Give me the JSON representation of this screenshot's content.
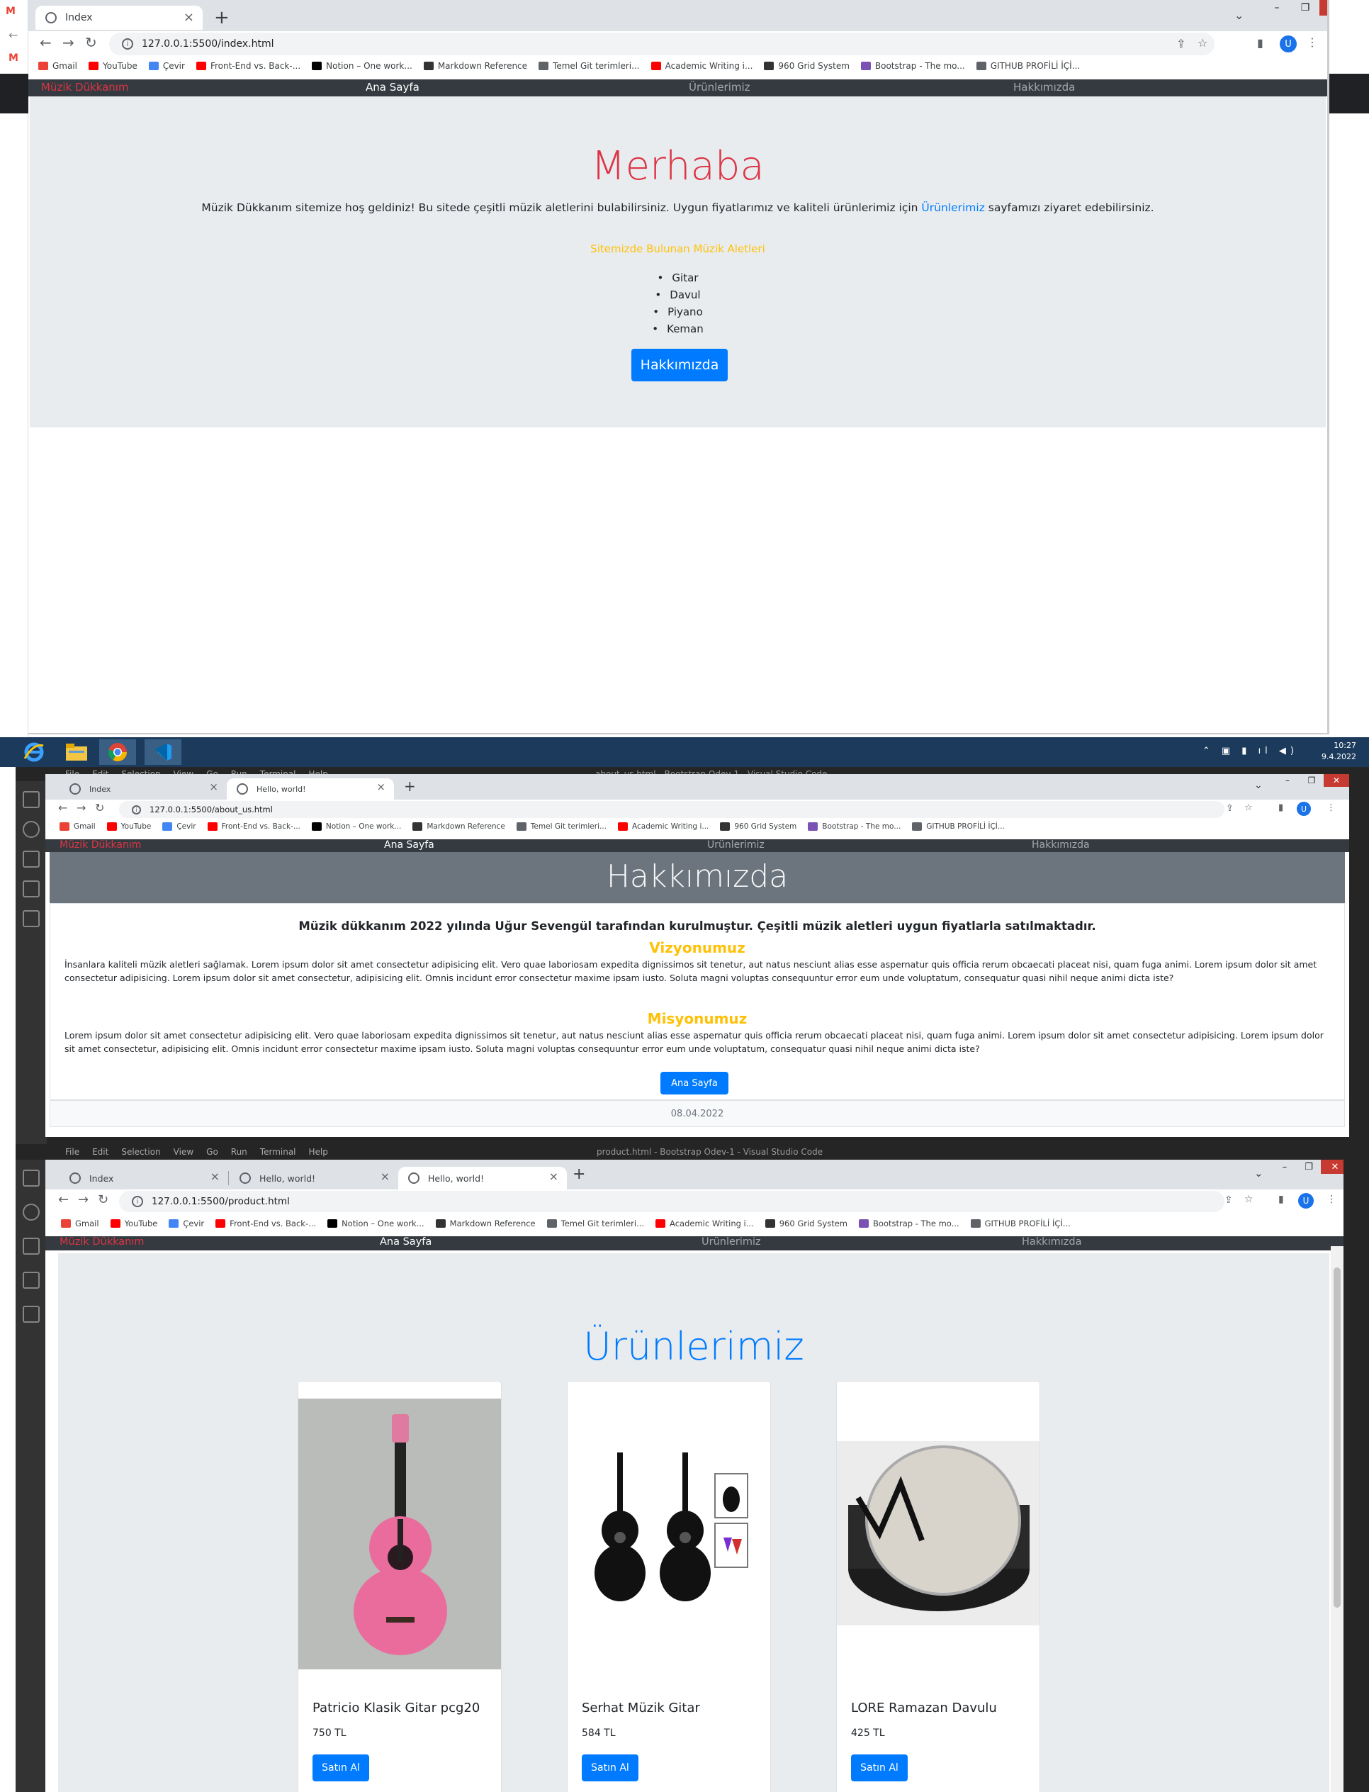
{
  "bookmarks": [
    {
      "label": "Gmail",
      "color": "#ea4335"
    },
    {
      "label": "YouTube",
      "color": "#ff0000"
    },
    {
      "label": "Çevir",
      "color": "#4285f4"
    },
    {
      "label": "Front-End vs. Back-...",
      "color": "#ff0000"
    },
    {
      "label": "Notion – One work...",
      "color": "#000000"
    },
    {
      "label": "Markdown Reference",
      "color": "#333333"
    },
    {
      "label": "Temel Git terimleri...",
      "color": "#5f6368"
    },
    {
      "label": "Academic Writing i...",
      "color": "#ff0000"
    },
    {
      "label": "960 Grid System",
      "color": "#333333"
    },
    {
      "label": "Bootstrap - The mo...",
      "color": "#7952b3"
    },
    {
      "label": "GITHUB PROFİLİ İÇİ...",
      "color": "#5f6368"
    }
  ],
  "nav": {
    "brand": "Müzik Dükkanım",
    "home": "Ana Sayfa",
    "products": "Ürünlerimiz",
    "about": "Hakkımızda"
  },
  "window1": {
    "tabs": [
      {
        "title": "Index"
      }
    ],
    "url": "127.0.0.1:5500/index.html",
    "profile": "U",
    "heading": "Merhaba",
    "lead_before": "Müzik Dükkanım sitemize hoş geldiniz! Bu sitede çeşitli müzik aletlerini bulabilirsiniz. Uygun fiyatlarımız ve kaliteli ürünlerimiz için ",
    "lead_link": "Ürünlerimiz",
    "lead_after": " sayfamızı ziyaret edebilirsiniz.",
    "subheading": "Sitemizde Bulunan Müzik Aletleri",
    "instruments": [
      "Gitar",
      "Davul",
      "Piyano",
      "Keman"
    ],
    "button": "Hakkımızda"
  },
  "taskbar": {
    "time": "10:27",
    "date": "9.4.2022"
  },
  "vscode": {
    "menu": [
      "File",
      "Edit",
      "Selection",
      "View",
      "Go",
      "Run",
      "Terminal",
      "Help"
    ],
    "title_about": "about_us.html - Bootstrap Odev-1 - Visual Studio Code",
    "title_product": "product.html - Bootstrap Odev-1 - Visual Studio Code"
  },
  "window2": {
    "tabs": [
      {
        "title": "Index"
      },
      {
        "title": "Hello, world!"
      }
    ],
    "url": "127.0.0.1:5500/about_us.html",
    "profile": "U",
    "heading": "Hakkımızda",
    "lead": "Müzik dükkanım 2022 yılında Uğur Sevengül tarafından kurulmuştur. Çeşitli müzik aletleri uygun fiyatlarla satılmaktadır.",
    "vision_title": "Vizyonumuz",
    "vision_text": "İnsanlara kaliteli müzik aletleri sağlamak. Lorem ipsum dolor sit amet consectetur adipisicing elit. Vero quae laboriosam expedita dignissimos sit tenetur, aut natus nesciunt alias esse aspernatur quis officia rerum obcaecati placeat nisi, quam fuga animi. Lorem ipsum dolor sit amet consectetur adipisicing. Lorem ipsum dolor sit amet consectetur, adipisicing elit. Omnis incidunt error consectetur maxime ipsam iusto. Soluta magni voluptas consequuntur error eum unde voluptatum, consequatur quasi nihil neque animi dicta iste?",
    "mission_title": "Misyonumuz",
    "mission_text": "Lorem ipsum dolor sit amet consectetur adipisicing elit. Vero quae laboriosam expedita dignissimos sit tenetur, aut natus nesciunt alias esse aspernatur quis officia rerum obcaecati placeat nisi, quam fuga animi. Lorem ipsum dolor sit amet consectetur adipisicing. Lorem ipsum dolor sit amet consectetur, adipisicing elit. Omnis incidunt error consectetur maxime ipsam iusto. Soluta magni voluptas consequuntur error eum unde voluptatum, consequatur quasi nihil neque animi dicta iste?",
    "button": "Ana Sayfa",
    "footer": "08.04.2022"
  },
  "window3": {
    "tabs": [
      {
        "title": "Index"
      },
      {
        "title": "Hello, world!"
      },
      {
        "title": "Hello, world!"
      }
    ],
    "url": "127.0.0.1:5500/product.html",
    "profile": "U",
    "heading": "Ürünlerimiz",
    "products": [
      {
        "name": "Patricio Klasik Gitar pcg20",
        "price": "750 TL",
        "button": "Satın Al"
      },
      {
        "name": "Serhat Müzik Gitar",
        "price": "584 TL",
        "button": "Satın Al"
      },
      {
        "name": "LORE Ramazan Davulu",
        "price": "425 TL",
        "button": "Satın Al"
      }
    ]
  }
}
